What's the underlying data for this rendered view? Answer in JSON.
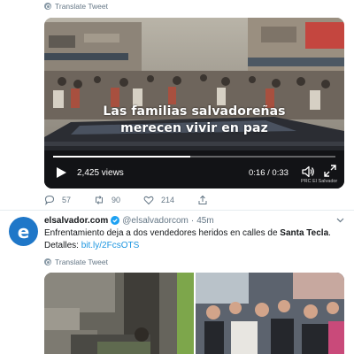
{
  "tweet1": {
    "translate_label": "Translate Tweet",
    "video": {
      "caption_line1": "Las familias salvadoreñas",
      "caption_line2": "merecen vivir en paz",
      "views": "2,425 views",
      "time": "0:16 / 0:33",
      "progress": 0.485,
      "watermark": "PRC El Salvador"
    },
    "actions": {
      "replies": "57",
      "retweets": "90",
      "likes": "214"
    }
  },
  "tweet2": {
    "avatar_letter": "e",
    "display_name": "elsalvador.com",
    "handle": "@elsalvadorcom",
    "dot": "·",
    "time_ago": "45m",
    "text_part1": "Enfrentamiento deja a dos vendedores heridos en calles de ",
    "text_bold": "Santa Tecla",
    "text_part2": ".",
    "text_detalles": "Detalles: ",
    "text_link": "bit.ly/2FcsOTS",
    "translate_label": "Translate Tweet"
  },
  "colors": {
    "link": "#1b95e0",
    "muted": "#657786",
    "avatar": "#1f77c8",
    "verified": "#1da1f2"
  },
  "icons": [
    "globe-icon",
    "play-icon",
    "volume-icon",
    "fullscreen-icon",
    "reply-icon",
    "retweet-icon",
    "like-icon",
    "share-icon",
    "verified-icon",
    "caret-down-icon"
  ]
}
